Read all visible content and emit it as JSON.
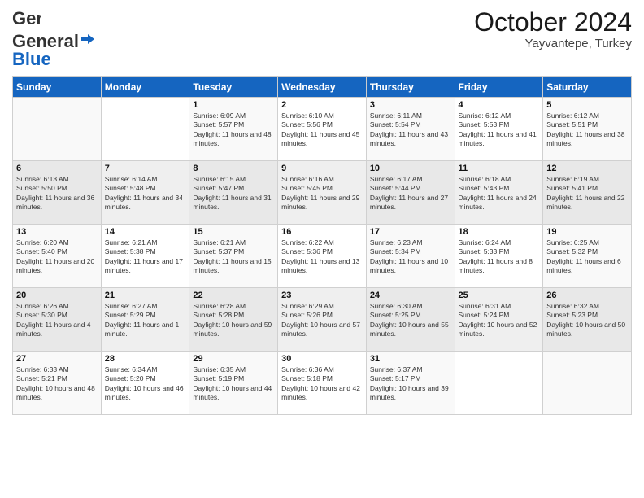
{
  "header": {
    "logo_general": "General",
    "logo_blue": "Blue",
    "month_year": "October 2024",
    "location": "Yayvantepe, Turkey"
  },
  "days_of_week": [
    "Sunday",
    "Monday",
    "Tuesday",
    "Wednesday",
    "Thursday",
    "Friday",
    "Saturday"
  ],
  "weeks": [
    [
      {
        "day": "",
        "sunrise": "",
        "sunset": "",
        "daylight": ""
      },
      {
        "day": "",
        "sunrise": "",
        "sunset": "",
        "daylight": ""
      },
      {
        "day": "1",
        "sunrise": "Sunrise: 6:09 AM",
        "sunset": "Sunset: 5:57 PM",
        "daylight": "Daylight: 11 hours and 48 minutes."
      },
      {
        "day": "2",
        "sunrise": "Sunrise: 6:10 AM",
        "sunset": "Sunset: 5:56 PM",
        "daylight": "Daylight: 11 hours and 45 minutes."
      },
      {
        "day": "3",
        "sunrise": "Sunrise: 6:11 AM",
        "sunset": "Sunset: 5:54 PM",
        "daylight": "Daylight: 11 hours and 43 minutes."
      },
      {
        "day": "4",
        "sunrise": "Sunrise: 6:12 AM",
        "sunset": "Sunset: 5:53 PM",
        "daylight": "Daylight: 11 hours and 41 minutes."
      },
      {
        "day": "5",
        "sunrise": "Sunrise: 6:12 AM",
        "sunset": "Sunset: 5:51 PM",
        "daylight": "Daylight: 11 hours and 38 minutes."
      }
    ],
    [
      {
        "day": "6",
        "sunrise": "Sunrise: 6:13 AM",
        "sunset": "Sunset: 5:50 PM",
        "daylight": "Daylight: 11 hours and 36 minutes."
      },
      {
        "day": "7",
        "sunrise": "Sunrise: 6:14 AM",
        "sunset": "Sunset: 5:48 PM",
        "daylight": "Daylight: 11 hours and 34 minutes."
      },
      {
        "day": "8",
        "sunrise": "Sunrise: 6:15 AM",
        "sunset": "Sunset: 5:47 PM",
        "daylight": "Daylight: 11 hours and 31 minutes."
      },
      {
        "day": "9",
        "sunrise": "Sunrise: 6:16 AM",
        "sunset": "Sunset: 5:45 PM",
        "daylight": "Daylight: 11 hours and 29 minutes."
      },
      {
        "day": "10",
        "sunrise": "Sunrise: 6:17 AM",
        "sunset": "Sunset: 5:44 PM",
        "daylight": "Daylight: 11 hours and 27 minutes."
      },
      {
        "day": "11",
        "sunrise": "Sunrise: 6:18 AM",
        "sunset": "Sunset: 5:43 PM",
        "daylight": "Daylight: 11 hours and 24 minutes."
      },
      {
        "day": "12",
        "sunrise": "Sunrise: 6:19 AM",
        "sunset": "Sunset: 5:41 PM",
        "daylight": "Daylight: 11 hours and 22 minutes."
      }
    ],
    [
      {
        "day": "13",
        "sunrise": "Sunrise: 6:20 AM",
        "sunset": "Sunset: 5:40 PM",
        "daylight": "Daylight: 11 hours and 20 minutes."
      },
      {
        "day": "14",
        "sunrise": "Sunrise: 6:21 AM",
        "sunset": "Sunset: 5:38 PM",
        "daylight": "Daylight: 11 hours and 17 minutes."
      },
      {
        "day": "15",
        "sunrise": "Sunrise: 6:21 AM",
        "sunset": "Sunset: 5:37 PM",
        "daylight": "Daylight: 11 hours and 15 minutes."
      },
      {
        "day": "16",
        "sunrise": "Sunrise: 6:22 AM",
        "sunset": "Sunset: 5:36 PM",
        "daylight": "Daylight: 11 hours and 13 minutes."
      },
      {
        "day": "17",
        "sunrise": "Sunrise: 6:23 AM",
        "sunset": "Sunset: 5:34 PM",
        "daylight": "Daylight: 11 hours and 10 minutes."
      },
      {
        "day": "18",
        "sunrise": "Sunrise: 6:24 AM",
        "sunset": "Sunset: 5:33 PM",
        "daylight": "Daylight: 11 hours and 8 minutes."
      },
      {
        "day": "19",
        "sunrise": "Sunrise: 6:25 AM",
        "sunset": "Sunset: 5:32 PM",
        "daylight": "Daylight: 11 hours and 6 minutes."
      }
    ],
    [
      {
        "day": "20",
        "sunrise": "Sunrise: 6:26 AM",
        "sunset": "Sunset: 5:30 PM",
        "daylight": "Daylight: 11 hours and 4 minutes."
      },
      {
        "day": "21",
        "sunrise": "Sunrise: 6:27 AM",
        "sunset": "Sunset: 5:29 PM",
        "daylight": "Daylight: 11 hours and 1 minute."
      },
      {
        "day": "22",
        "sunrise": "Sunrise: 6:28 AM",
        "sunset": "Sunset: 5:28 PM",
        "daylight": "Daylight: 10 hours and 59 minutes."
      },
      {
        "day": "23",
        "sunrise": "Sunrise: 6:29 AM",
        "sunset": "Sunset: 5:26 PM",
        "daylight": "Daylight: 10 hours and 57 minutes."
      },
      {
        "day": "24",
        "sunrise": "Sunrise: 6:30 AM",
        "sunset": "Sunset: 5:25 PM",
        "daylight": "Daylight: 10 hours and 55 minutes."
      },
      {
        "day": "25",
        "sunrise": "Sunrise: 6:31 AM",
        "sunset": "Sunset: 5:24 PM",
        "daylight": "Daylight: 10 hours and 52 minutes."
      },
      {
        "day": "26",
        "sunrise": "Sunrise: 6:32 AM",
        "sunset": "Sunset: 5:23 PM",
        "daylight": "Daylight: 10 hours and 50 minutes."
      }
    ],
    [
      {
        "day": "27",
        "sunrise": "Sunrise: 6:33 AM",
        "sunset": "Sunset: 5:21 PM",
        "daylight": "Daylight: 10 hours and 48 minutes."
      },
      {
        "day": "28",
        "sunrise": "Sunrise: 6:34 AM",
        "sunset": "Sunset: 5:20 PM",
        "daylight": "Daylight: 10 hours and 46 minutes."
      },
      {
        "day": "29",
        "sunrise": "Sunrise: 6:35 AM",
        "sunset": "Sunset: 5:19 PM",
        "daylight": "Daylight: 10 hours and 44 minutes."
      },
      {
        "day": "30",
        "sunrise": "Sunrise: 6:36 AM",
        "sunset": "Sunset: 5:18 PM",
        "daylight": "Daylight: 10 hours and 42 minutes."
      },
      {
        "day": "31",
        "sunrise": "Sunrise: 6:37 AM",
        "sunset": "Sunset: 5:17 PM",
        "daylight": "Daylight: 10 hours and 39 minutes."
      },
      {
        "day": "",
        "sunrise": "",
        "sunset": "",
        "daylight": ""
      },
      {
        "day": "",
        "sunrise": "",
        "sunset": "",
        "daylight": ""
      }
    ]
  ]
}
